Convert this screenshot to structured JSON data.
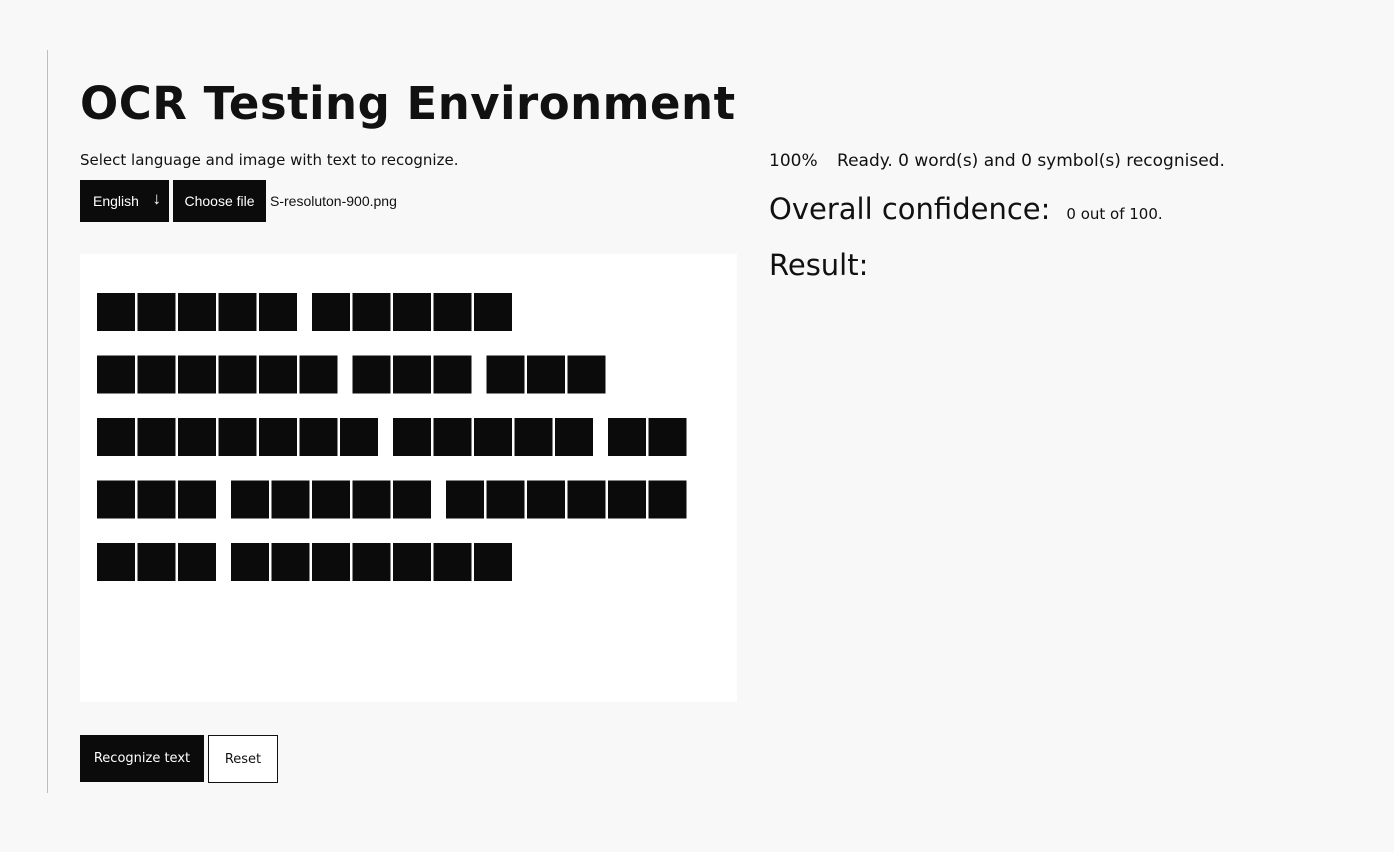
{
  "page": {
    "title": "OCR Testing Environment",
    "instructions": "Select language and image with text to recognize."
  },
  "controls": {
    "language": "English",
    "language_arrow_glyph": "↓",
    "choose_file_label": "Choose file",
    "file_name": "S-resoluton-900.png"
  },
  "preview_image": {
    "alt": "",
    "rows_of_redacted_glyphs": [
      [
        5,
        5
      ],
      [
        6,
        3,
        3
      ],
      [
        7,
        5,
        2
      ],
      [
        3,
        5,
        6
      ],
      [
        3,
        7
      ]
    ]
  },
  "actions": {
    "recognize_label": "Recognize text",
    "reset_label": "Reset"
  },
  "status": {
    "progress": "100%",
    "message": "Ready. 0 word(s) and 0 symbol(s) recognised."
  },
  "confidence": {
    "label": "Overall confidence:",
    "value": "0 out of 100."
  },
  "result": {
    "label": "Result:",
    "text": ""
  },
  "colors": {
    "background": "#f8f8f8",
    "dark": "#0b0b0b",
    "text": "#111111",
    "frame_line": "#bdbdbd"
  }
}
